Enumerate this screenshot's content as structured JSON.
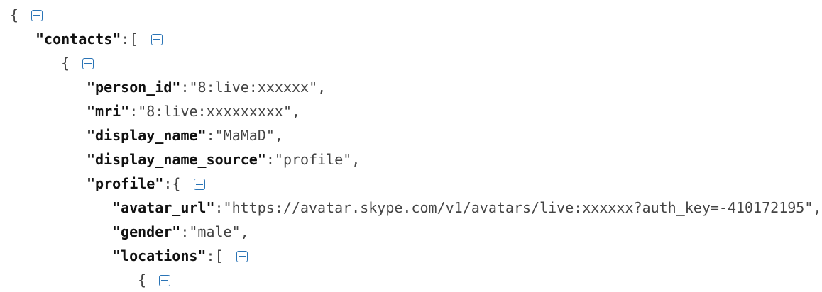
{
  "json": {
    "open_brace": "{",
    "close_brace": "}",
    "open_bracket": "[",
    "colon": ":",
    "comma": ",",
    "quote": "\"",
    "collapse_icon": "collapse-icon",
    "keys": {
      "contacts": "\"contacts\"",
      "person_id": "\"person_id\"",
      "mri": "\"mri\"",
      "display_name": "\"display_name\"",
      "display_name_source": "\"display_name_source\"",
      "profile": "\"profile\"",
      "avatar_url": "\"avatar_url\"",
      "gender": "\"gender\"",
      "locations": "\"locations\""
    },
    "values": {
      "person_id": "\"8:live:xxxxxx\"",
      "mri": "\"8:live:xxxxxxxxx\"",
      "display_name": "\"MaMaD\"",
      "display_name_source": "\"profile\"",
      "avatar_url": "\"https://avatar.skype.com/v1/avatars/live:xxxxxx?auth_key=-410172195\"",
      "gender": "\"male\""
    }
  },
  "colors": {
    "key": "#111111",
    "value": "#444444",
    "toggle": "#2a74b6",
    "background": "#ffffff"
  }
}
